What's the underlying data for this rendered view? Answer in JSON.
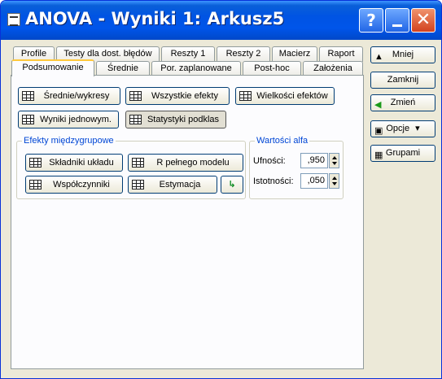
{
  "window": {
    "title": "ANOVA - Wyniki 1: Arkusz5"
  },
  "titlebar": {
    "help": "?",
    "close": "✕"
  },
  "tabs_back": [
    "Profile",
    "Testy dla dost. błędów",
    "Reszty 1",
    "Reszty 2",
    "Macierz",
    "Raport"
  ],
  "tabs_front": [
    "Podsumowanie",
    "Średnie",
    "Por. zaplanowane",
    "Post-hoc",
    "Założenia"
  ],
  "main": {
    "btn_srednie": "Średnie/wykresy",
    "btn_wszystkie": "Wszystkie efekty",
    "btn_wielkosci": "Wielkości efektów",
    "btn_wyniki": "Wyniki jednowym.",
    "btn_statystyki": "Statystyki podklas",
    "group_efekty": "Efekty międzygrupowe",
    "btn_skladniki": "Składniki układu",
    "btn_r": "R pełnego modelu",
    "btn_wspolczynniki": "Współczynniki",
    "btn_estymacja": "Estymacja",
    "group_alfa": "Wartości alfa",
    "ufnosci_label": "Ufności:",
    "ufnosci_value": ",950",
    "istotnosci_label": "Istotności:",
    "istotnosci_value": ",050"
  },
  "side": {
    "mniej": "Mniej",
    "zamknij": "Zamknij",
    "zmien": "Zmień",
    "opcje": "Opcje",
    "grupami": "Grupami"
  },
  "colors": {
    "titlebar": "#0054e3",
    "group_label": "#0046d5",
    "close": "#d2421f"
  }
}
